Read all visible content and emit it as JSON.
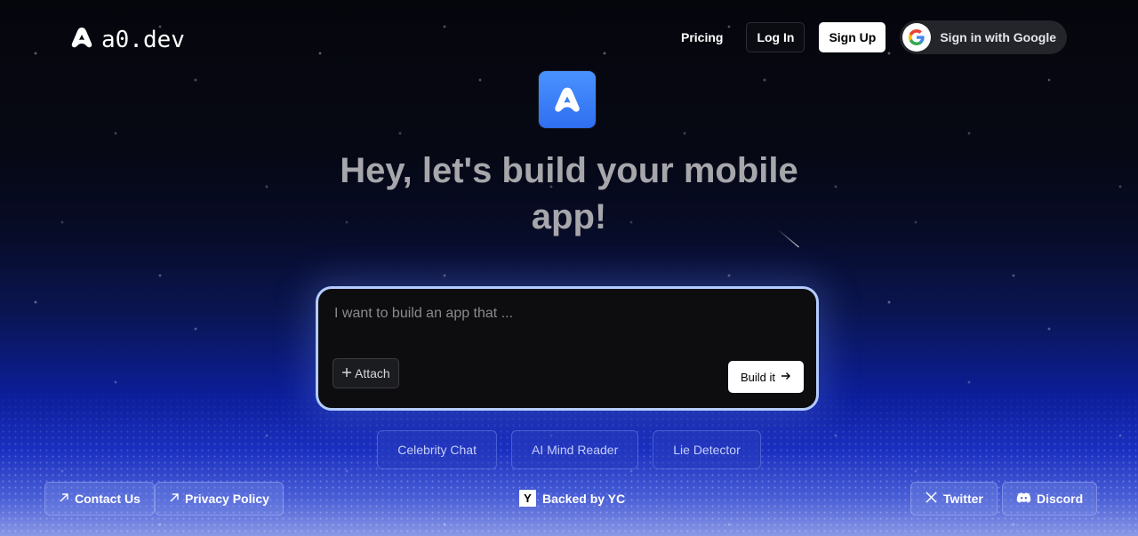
{
  "brand": {
    "name": "a0.dev"
  },
  "nav": {
    "pricing": "Pricing",
    "login": "Log In",
    "signup": "Sign Up",
    "google": "Sign in with Google"
  },
  "hero": {
    "title_line1": "Hey, let's build your mobile",
    "title_line2": "app!"
  },
  "prompt": {
    "placeholder": "I want to build an app that ...",
    "value": "",
    "attach_label": "Attach",
    "build_label": "Build it"
  },
  "suggestions": [
    "Celebrity Chat",
    "AI Mind Reader",
    "Lie Detector"
  ],
  "footer": {
    "contact": "Contact Us",
    "privacy": "Privacy Policy",
    "backed_badge": "Y",
    "backed": "Backed by YC",
    "twitter": "Twitter",
    "discord": "Discord"
  },
  "colors": {
    "accent_blue": "#3a7ef8",
    "prompt_border": "#b4ccff",
    "chip_text": "#c7cffa"
  },
  "icons": [
    "a0-logo-icon",
    "google-icon",
    "plus-icon",
    "arrow-right-icon",
    "arrow-up-right-icon",
    "x-icon",
    "discord-icon"
  ]
}
